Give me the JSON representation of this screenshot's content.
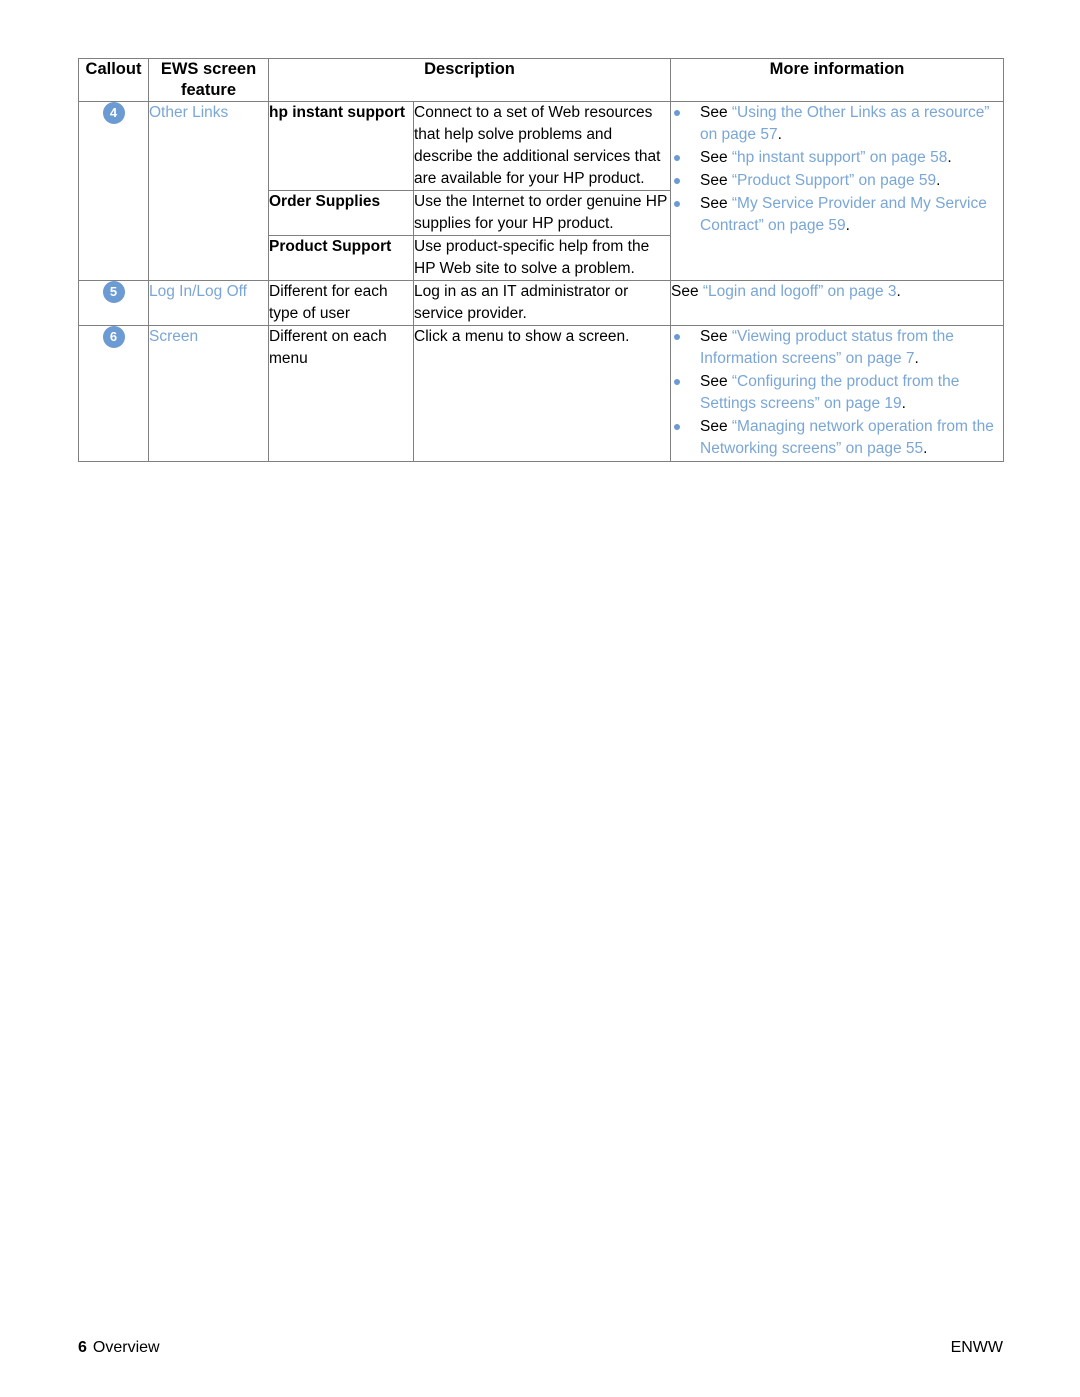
{
  "table": {
    "headers": {
      "callout": "Callout",
      "ews_feature": "EWS screen feature",
      "description": "Description",
      "more_information": "More information"
    },
    "rows": [
      {
        "callout": "4",
        "ews_feature": "Other Links",
        "sub_rows": [
          {
            "term": "hp instant support",
            "description": "Connect to a set of Web resources that help solve problems and describe the additional services that are available for your HP product."
          },
          {
            "term": "Order Supplies",
            "description": "Use the Internet to order genuine HP supplies for your HP product."
          },
          {
            "term": "Product Support",
            "description": "Use product-specific help from the HP Web site to solve a problem."
          }
        ],
        "more_information": {
          "style": "bulleted",
          "items": [
            {
              "see": "See ",
              "link": "“Using the Other Links as a resource” on page 57",
              "tail": "."
            },
            {
              "see": "See ",
              "link": "“hp instant support” on page 58",
              "tail": "."
            },
            {
              "see": "See ",
              "link": "“Product Support” on page 59",
              "tail": "."
            },
            {
              "see": "See ",
              "link": "“My Service Provider and My Service Contract” on page 59",
              "tail": "."
            }
          ]
        }
      },
      {
        "callout": "5",
        "ews_feature": "Log In/Log Off",
        "sub_rows": [
          {
            "term": "Different for each type of user",
            "description": "Log in as an IT administrator or service provider."
          }
        ],
        "more_information": {
          "style": "plain",
          "items": [
            {
              "see": "See ",
              "link": "“Login and logoff” on page 3",
              "tail": "."
            }
          ]
        }
      },
      {
        "callout": "6",
        "ews_feature": "Screen",
        "sub_rows": [
          {
            "term": "Different on each menu",
            "description": "Click a menu to show a screen."
          }
        ],
        "more_information": {
          "style": "bulleted",
          "items": [
            {
              "see": "See ",
              "link": "“Viewing product status from the Information screens” on page 7",
              "tail": "."
            },
            {
              "see": "See ",
              "link": "“Configuring the product from the Settings screens” on page 19",
              "tail": "."
            },
            {
              "see": "See ",
              "link": "“Managing network operation from the Networking screens” on page 55",
              "tail": "."
            }
          ]
        }
      }
    ]
  },
  "footer": {
    "page_number": "6",
    "section": "Overview",
    "locale": "ENWW"
  },
  "colors": {
    "link_blue": "#7aa6d6",
    "badge_blue": "#6b9bd2",
    "border_gray": "#808080"
  }
}
